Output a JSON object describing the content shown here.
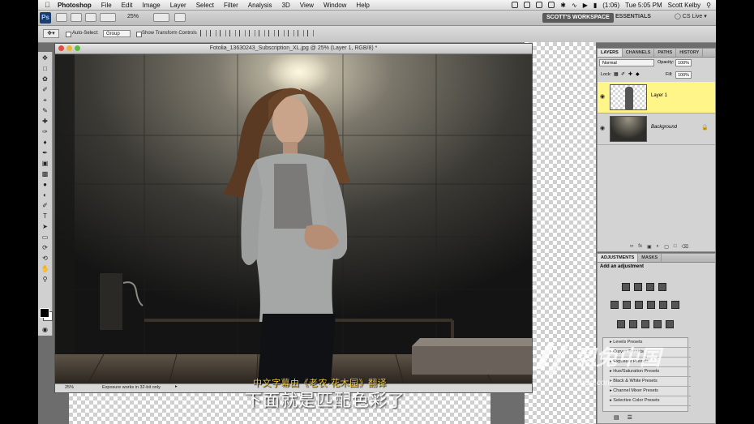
{
  "menubar": {
    "app_name": "Photoshop",
    "items": [
      "File",
      "Edit",
      "Image",
      "Layer",
      "Select",
      "Filter",
      "Analysis",
      "3D",
      "View",
      "Window",
      "Help"
    ],
    "battery": "(1:06)",
    "clock": "Tue 5:05 PM",
    "user": "Scott Kelby"
  },
  "appbar": {
    "logo": "Ps",
    "zoom": "25%",
    "workspace_active": "SCOTT'S WORKSPACE",
    "workspace_essentials": "ESSENTIALS",
    "cs_live": "CS Live"
  },
  "options": {
    "auto_select_label": "Auto-Select:",
    "auto_select_value": "Group",
    "transform_label": "Show Transform Controls"
  },
  "document": {
    "title": "Fotolia_13630243_Subscription_XL.jpg @ 25% (Layer 1, RGB/8) *",
    "status_zoom": "25%",
    "status_text": "Exposure works in 32-bit only"
  },
  "layers_panel": {
    "tabs": [
      "LAYERS",
      "CHANNELS",
      "PATHS",
      "HISTORY"
    ],
    "blend_mode": "Normal",
    "opacity_label": "Opacity:",
    "opacity_value": "100%",
    "lock_label": "Lock:",
    "fill_label": "Fill:",
    "fill_value": "100%",
    "layers": [
      {
        "name": "Layer 1",
        "selected": true
      },
      {
        "name": "Background",
        "selected": false
      }
    ]
  },
  "adjustments_panel": {
    "tabs": [
      "ADJUSTMENTS",
      "MASKS"
    ],
    "heading": "Add an adjustment",
    "presets": [
      "Levels Presets",
      "Curves Presets",
      "Exposure Presets",
      "Hue/Saturation Presets",
      "Black & White Presets",
      "Channel Mixer Presets",
      "Selective Color Presets"
    ]
  },
  "subtitles": {
    "credit": "中文字幕由《老农·花木园》翻译",
    "line": "下面就是匹配色彩了"
  },
  "watermark": {
    "brand": "羽兔中国",
    "url": "hxsd.com"
  },
  "colors": {
    "selected_layer": "#fff588",
    "accent": "#1c3d6e"
  }
}
